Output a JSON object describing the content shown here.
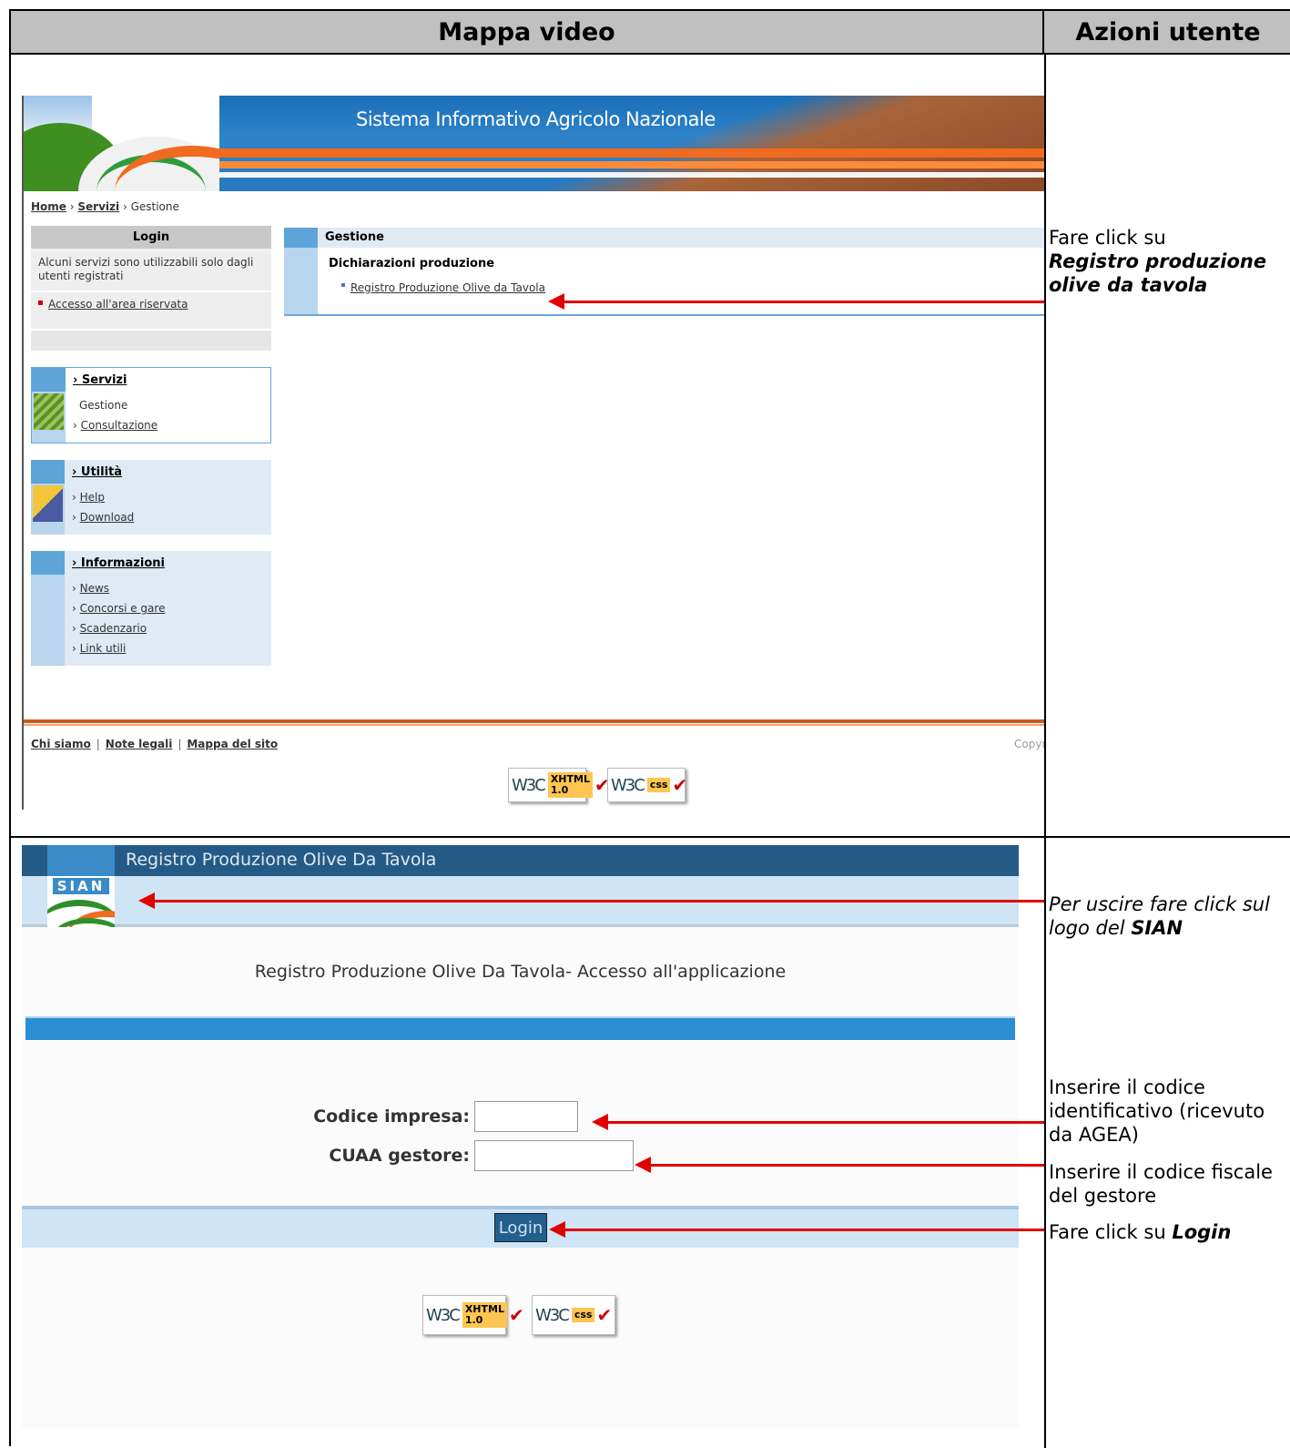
{
  "table": {
    "header_left": "Mappa video",
    "header_right": "Azioni utente"
  },
  "notes": {
    "n1_prefix": "Fare click su",
    "n1_bold": "Registro produzione olive da tavola",
    "n2_text": "Per uscire fare click sul logo del",
    "n2_bold": "SIAN",
    "n3_text": "Inserire il codice identificativo (ricevuto da AGEA)",
    "n4_text": "Inserire il codice fiscale del gestore",
    "n5_prefix": "Fare click su",
    "n5_bold": "Login"
  },
  "portal": {
    "logo_text": "SIAN",
    "banner_title": "Sistema Informativo Agricolo Nazionale",
    "breadcrumb": {
      "home": "Home",
      "servizi": "Servizi",
      "current": "Gestione"
    },
    "login_box": {
      "title": "Login",
      "text": "Alcuni servizi sono utilizzabili solo dagli utenti registrati",
      "link": "Accesso all'area riservata"
    },
    "menu_servizi": {
      "title": "Servizi",
      "items": [
        "Gestione",
        "Consultazione"
      ]
    },
    "menu_utilita": {
      "title": "Utilità",
      "items": [
        "Help",
        "Download"
      ]
    },
    "menu_info": {
      "title": "Informazioni",
      "items": [
        "News",
        "Concorsi e gare",
        "Scadenzario",
        "Link utili"
      ]
    },
    "main": {
      "title": "Gestione",
      "section": "Dichiarazioni produzione",
      "link": "Registro Produzione Olive da Tavola"
    },
    "footer": {
      "chi_siamo": "Chi siamo",
      "note_legali": "Note legali",
      "mappa": "Mappa del sito",
      "copyright": "Copyr"
    },
    "badges": {
      "w3c": "W3C",
      "xhtml": "XHTML 1.0",
      "css": "css"
    }
  },
  "login_app": {
    "bar_title": "Registro Produzione Olive Da Tavola",
    "logo_text": "SIAN",
    "heading": "Registro Produzione Olive Da Tavola- Accesso all'applicazione",
    "codice_label": "Codice impresa:",
    "codice_value": "",
    "cuaa_label": "CUAA gestore:",
    "cuaa_value": "",
    "login_button": "Login",
    "badges": {
      "w3c": "W3C",
      "xhtml": "XHTML 1.0",
      "css": "css"
    }
  },
  "colors": {
    "arrow": "#e10000",
    "header_bg": "#c0c0c0",
    "sian_blue": "#2b8ed3",
    "sian_orange": "#f06a20"
  }
}
